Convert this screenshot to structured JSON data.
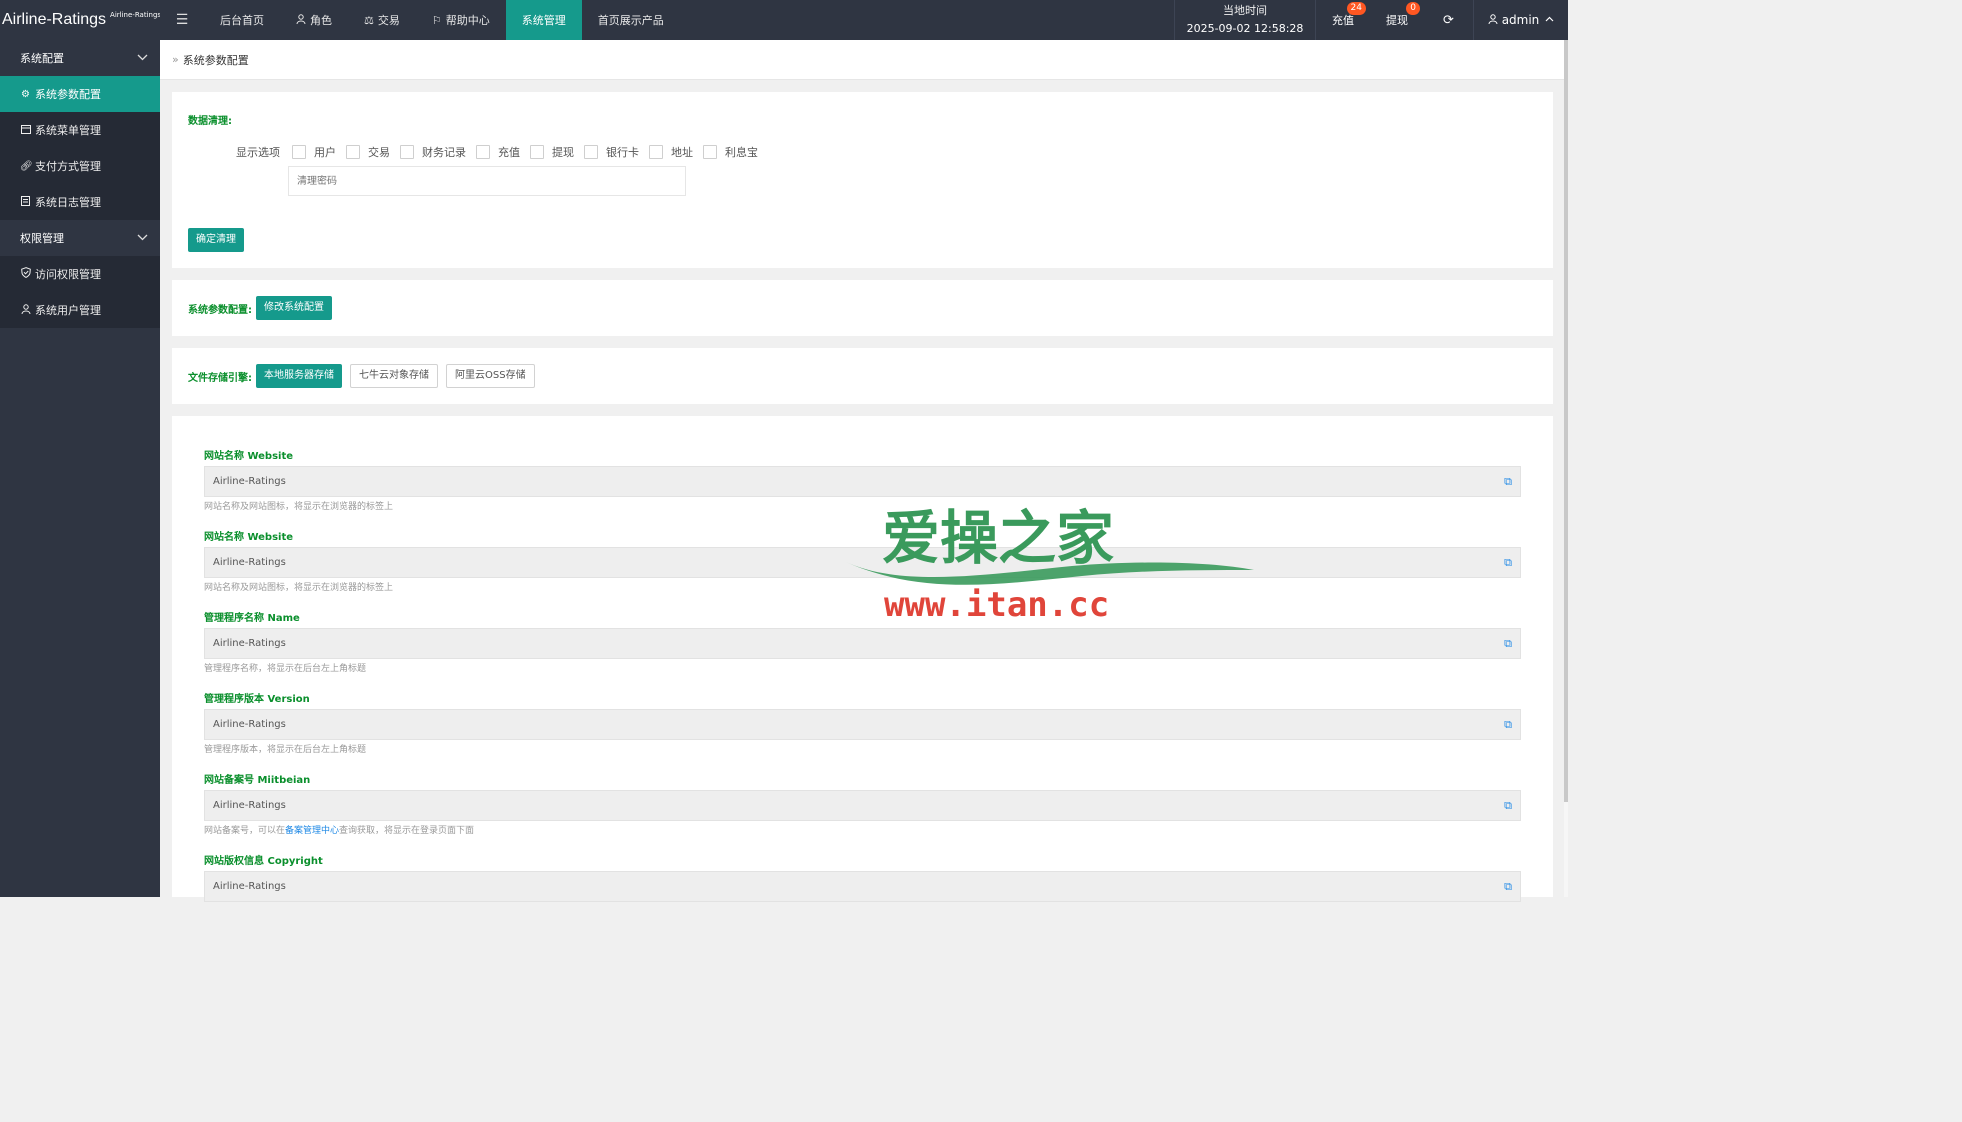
{
  "brand": {
    "name": "Airline-Ratings",
    "sub": "Airline-Ratings"
  },
  "nav": [
    {
      "label": "后台首页",
      "icon": ""
    },
    {
      "label": "角色",
      "icon": "user-icon"
    },
    {
      "label": "交易",
      "icon": "scale-icon"
    },
    {
      "label": "帮助中心",
      "icon": "flag-icon"
    },
    {
      "label": "系统管理",
      "icon": "",
      "active": true
    },
    {
      "label": "首页展示产品",
      "icon": ""
    }
  ],
  "clock": {
    "label": "当地时间",
    "time": "2025-09-02 12:58:28"
  },
  "topbar": {
    "recharge": "充值",
    "recharge_badge": "24",
    "withdraw": "提现",
    "withdraw_badge": "0",
    "user": "admin"
  },
  "sidebar": {
    "group1": "系统配置",
    "items1": [
      "系统参数配置",
      "系统菜单管理",
      "支付方式管理",
      "系统日志管理"
    ],
    "group2": "权限管理",
    "items2": [
      "访问权限管理",
      "系统用户管理"
    ]
  },
  "breadcrumb": "系统参数配置",
  "clean": {
    "title": "数据清理:",
    "options_label": "显示选项",
    "options": [
      "用户",
      "交易",
      "财务记录",
      "充值",
      "提现",
      "银行卡",
      "地址",
      "利息宝"
    ],
    "password_placeholder": "清理密码",
    "confirm": "确定清理"
  },
  "config": {
    "title": "系统参数配置:",
    "button": "修改系统配置"
  },
  "storage": {
    "title": "文件存储引擎:",
    "options": [
      "本地服务器存储",
      "七牛云对象存储",
      "阿里云OSS存储"
    ]
  },
  "fields": [
    {
      "label": "网站名称 Website",
      "value": "Airline-Ratings",
      "hint": "网站名称及网站图标，将显示在浏览器的标签上"
    },
    {
      "label": "网站名称 Website",
      "value": "Airline-Ratings",
      "hint": "网站名称及网站图标，将显示在浏览器的标签上"
    },
    {
      "label": "管理程序名称 Name",
      "value": "Airline-Ratings",
      "hint": "管理程序名称，将显示在后台左上角标题"
    },
    {
      "label": "管理程序版本 Version",
      "value": "Airline-Ratings",
      "hint": "管理程序版本，将显示在后台左上角标题"
    },
    {
      "label": "网站备案号 Miitbeian",
      "value": "Airline-Ratings",
      "hint_pre": "网站备案号，可以在",
      "hint_link": "备案管理中心",
      "hint_post": "查询获取，将显示在登录页面下面"
    },
    {
      "label": "网站版权信息 Copyright",
      "value": "Airline-Ratings"
    }
  ],
  "watermark": {
    "text1": "爱操之家",
    "text2": "www.itan.cc"
  },
  "colors": {
    "sidebar": "#2f3542",
    "accent": "#159a8c",
    "label_green": "#0a8f2c",
    "badge": "#ff5722"
  }
}
